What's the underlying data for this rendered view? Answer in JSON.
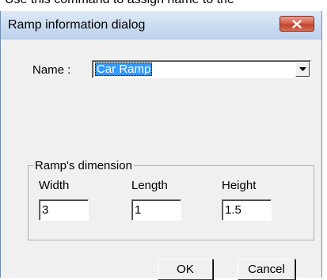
{
  "page": {
    "top_text": "Use this command to assign name to the"
  },
  "window": {
    "title": "Ramp information dialog",
    "close_icon": "close-x-icon"
  },
  "form": {
    "name_label": "Name :",
    "name_value": "Car Ramp",
    "dropdown_icon": "dropdown-arrow-icon"
  },
  "dimensions": {
    "group_label": "Ramp's dimension",
    "width_label": "Width",
    "width_value": "3",
    "length_label": "Length",
    "length_value": "1",
    "height_label": "Height",
    "height_value": "1.5"
  },
  "buttons": {
    "ok": "OK",
    "cancel": "Cancel"
  },
  "colors": {
    "selection": "#3399ff",
    "close_button": "#c74a33",
    "titlebar": "#c9dbf0"
  }
}
